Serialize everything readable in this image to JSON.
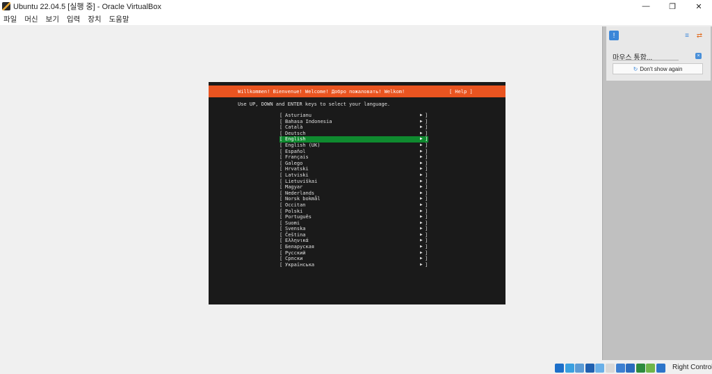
{
  "window": {
    "title": "Ubuntu 22.04.5 [실행 중] - Oracle VirtualBox",
    "minimize_glyph": "—",
    "maximize_glyph": "❐",
    "close_glyph": "✕"
  },
  "menu": [
    "파일",
    "머신",
    "보기",
    "입력",
    "장치",
    "도움말"
  ],
  "vm_screen": {
    "header": "Willkommen! Bienvenue! Welcome! Добро пожаловать! Welkom!",
    "help": "[ Help ]",
    "instruction": "Use UP, DOWN and ENTER keys to select your language.",
    "left_bracket": "[",
    "right_bracket": "]",
    "arrow": "▶",
    "selected_index": 4,
    "languages": [
      "Asturianu",
      "Bahasa Indonesia",
      "Català",
      "Deutsch",
      "English",
      "English (UK)",
      "Español",
      "Français",
      "Galego",
      "Hrvatski",
      "Latviski",
      "Lietuviškai",
      "Magyar",
      "Nederlands",
      "Norsk bokmål",
      "Occitan",
      "Polski",
      "Português",
      "Suomi",
      "Svenska",
      "Čeština",
      "Ελληνικά",
      "Беларуская",
      "Русский",
      "Српски",
      "Українська"
    ]
  },
  "side_panel": {
    "title": "마우스 통합...",
    "dont_show_label": "Don't show again",
    "dont_show_icon": "↻"
  },
  "status": {
    "right_text": "Right Control",
    "icon_colors": [
      "#1c6fc9",
      "#3aa0e0",
      "#5b9bd5",
      "#2060b0",
      "#6ab0e8",
      "#d8d8d8",
      "#3c7fd1",
      "#2a6bbd",
      "#2e8b3e",
      "#6fb64a",
      "#2c74c9"
    ],
    "icon_names": [
      "hdd-icon",
      "optical-disk-icon",
      "audio-icon",
      "network-icon",
      "usb-icon",
      "shared-folder-icon",
      "display-icon",
      "recording-icon",
      "cpu-icon",
      "mouse-integration-icon",
      "keyboard-icon"
    ]
  },
  "colors": {
    "ubuntu_orange": "#e95420",
    "selection_green": "#0f8a2f",
    "vm_bg": "#1a1a1a"
  }
}
